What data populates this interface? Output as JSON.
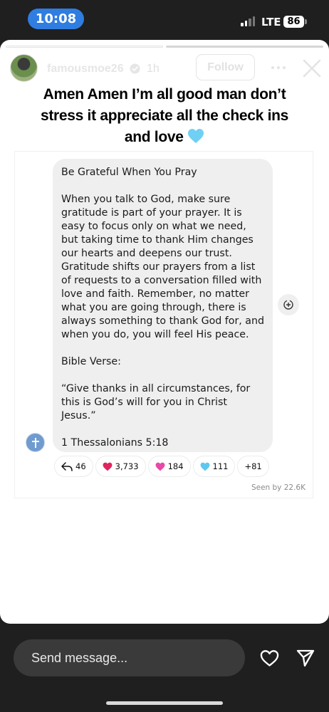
{
  "status_bar": {
    "time": "10:08",
    "network": "LTE",
    "battery": "86"
  },
  "story": {
    "progress_segments": 2,
    "progress_active": 1,
    "username": "famousmoe26",
    "verified": true,
    "age": "1h",
    "follow_label": "Follow",
    "caption": "Amen Amen I’m all good man don’t stress it appreciate all the check ins and love",
    "caption_emoji": "light-blue-heart"
  },
  "message": {
    "paragraphs": [
      "Be Grateful When You Pray",
      "When you talk to God, make sure gratitude is part of your prayer. It is easy to focus only on what we need, but taking time to thank Him changes our hearts and deepens our trust. Gratitude shifts our prayers from a list of requests to a conversation filled with love and faith. Remember, no matter what you are going through, there is always something to thank God for, and when you do, you will feel His peace.",
      "Bible Verse:",
      "“Give thanks in all circumstances, for this is God’s will for you in Christ Jesus.”",
      "1 Thessalonians 5:18"
    ],
    "reactions": [
      {
        "icon": "reply-icon",
        "count": "46"
      },
      {
        "icon": "red-heart-icon",
        "count": "3,733"
      },
      {
        "icon": "pink-heart-icon",
        "count": "184"
      },
      {
        "icon": "blue-heart-icon",
        "count": "111"
      },
      {
        "icon": "",
        "count": "+81"
      }
    ],
    "seen": "Seen by 22.6K"
  },
  "composer": {
    "placeholder": "Send message..."
  },
  "colors": {
    "time_pill": "#2f7de1",
    "red_heart": "#e0245e",
    "pink_heart": "#e64aa8",
    "blue_heart": "#5cc8f0"
  }
}
